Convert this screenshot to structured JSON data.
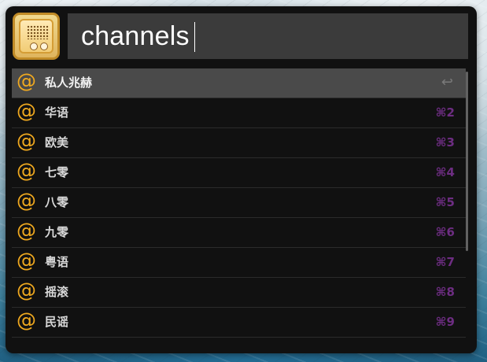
{
  "query": {
    "value": "channels"
  },
  "results": [
    {
      "label": "私人兆赫",
      "shortcut": "↩",
      "selected": true
    },
    {
      "label": "华语",
      "shortcut": "⌘2",
      "selected": false
    },
    {
      "label": "欧美",
      "shortcut": "⌘3",
      "selected": false
    },
    {
      "label": "七零",
      "shortcut": "⌘4",
      "selected": false
    },
    {
      "label": "八零",
      "shortcut": "⌘5",
      "selected": false
    },
    {
      "label": "九零",
      "shortcut": "⌘6",
      "selected": false
    },
    {
      "label": "粤语",
      "shortcut": "⌘7",
      "selected": false
    },
    {
      "label": "摇滚",
      "shortcut": "⌘8",
      "selected": false
    },
    {
      "label": "民谣",
      "shortcut": "⌘9",
      "selected": false
    }
  ],
  "icons": {
    "app": "radio-icon",
    "item": "@"
  },
  "colors": {
    "accent": "#f0a91f",
    "shortcut": "#6d2d82",
    "selected_row": "#4a4a4a"
  }
}
